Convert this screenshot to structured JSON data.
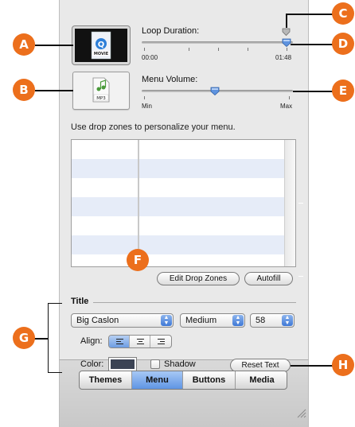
{
  "loop": {
    "label": "Loop Duration:",
    "start_time": "00:00",
    "end_time": "01:48",
    "value_fraction": 1.0
  },
  "volume": {
    "label": "Menu Volume:",
    "min_label": "Min",
    "max_label": "Max",
    "value_fraction": 0.5
  },
  "thumbnails": {
    "movie_badge": "MOVIE",
    "audio_badge": "MP3"
  },
  "drop_zones": {
    "instructions": "Use drop zones to personalize your menu.",
    "edit_button": "Edit Drop Zones",
    "autofill_button": "Autofill"
  },
  "title_section": {
    "heading": "Title",
    "font": "Big Caslon",
    "weight": "Medium",
    "size": "58",
    "align_label": "Align:",
    "align_selected": "left",
    "color_label": "Color:",
    "color_value": "#3b4354",
    "shadow_label": "Shadow",
    "shadow_checked": false,
    "reset_button": "Reset Text"
  },
  "tabs": [
    {
      "label": "Themes",
      "selected": false
    },
    {
      "label": "Menu",
      "selected": true
    },
    {
      "label": "Buttons",
      "selected": false
    },
    {
      "label": "Media",
      "selected": false
    }
  ],
  "callouts": {
    "a": "A",
    "b": "B",
    "c": "C",
    "d": "D",
    "e": "E",
    "f": "F",
    "g": "G",
    "h": "H"
  },
  "colors": {
    "callout": "#ec6f1c",
    "selection_blue": "#5f95e4",
    "panel": "#e9e9e9"
  }
}
